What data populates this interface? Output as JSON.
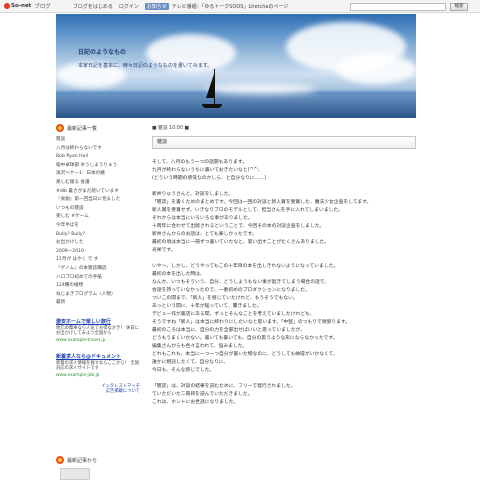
{
  "topbar": {
    "brand": "So-net",
    "blog_label": "ブログ",
    "nav": [
      "ブログをはじめる",
      "ログイン"
    ],
    "news_badge": "お知らせ",
    "news_text": "テレビ番組：「ゆるトークSOOS」Lhetchaのページ",
    "search_button": "検索"
  },
  "header": {
    "title": "日記のようなもの",
    "description": "本家日記を基本に、時々日記のようなものを書いてみます。"
  },
  "sidebar": {
    "heading": "最新記事一覧",
    "items": [
      "雑談",
      "八月は終わらないです",
      "Bob Ryan Hall",
      "稲中卓球部 ゆうしようりゅう",
      "滝沢ヘヤー1：日本の嬉",
      "楽しむ寝る 会議",
      "#dlb 暑さがまだ続いています",
      "『食劇』第一回当日に見ました",
      "いつもの雑談",
      "楽しむ #ゲーム",
      "今年半ばを",
      "Bully? Bully?",
      "お出かけした",
      "2009ー2010",
      "11月が はやく で す",
      "『ゲノム』の本雑誌購読",
      "ハロプロ初めての手紙",
      "124種の植物",
      "ねじまきプログラム（人物）",
      "最新"
    ],
    "ads": [
      {
        "title": "激安ホームで楽しい旅行",
        "text": "地元の電車なら人気でお得なかき！ 休日にお出かけしてみよう全国から",
        "url": "www.example-travel.jp"
      },
      {
        "title": "新着求人なら@ドキュメント",
        "text": "新着の求人情報を探すならここから！ 全国対応の求人サイトです",
        "url": "www.example-job.jp"
      }
    ],
    "ad_footer": [
      "インタレストマッチ",
      "広告掲載について"
    ],
    "heading2": "最新記事から"
  },
  "main": {
    "breadcrumb": "■ 雑談 10:00 ■",
    "entry_title": "雑談",
    "paragraphs": [
      [
        "そして、八月のもう一つの話題もあります。",
        "九月が終わらないうちに書いておきたいなと(^^;",
        "(どういう時期の感覚なのかしら、と自分なりに……)"
      ],
      [
        "新井りゅうさんと、対談をしました。",
        "「雑誌」を書くためのまとめです。今回は一回の対談と新人賞を受賞した、魔法少女企画をしてます。",
        "新人賞を受賞せず、いきなりプロのモデルとして、担当さんを手に入れてしまいました。",
        "それからは本当にいろいろな事がありました。",
        "十周年に合わせて出版されるということで、今回その本の対談企画をしました。",
        "新井さんからのお話は、とても楽しかったです。",
        "最初の頃は本当に一冊ずつ書いていたなと、思い出すことがたくさんありました。",
        "光栄です。"
      ],
      [
        "いや～、しかし、どうやってもこの十年目の本を出しきれないようになっていました。",
        "最初の本を出した時は、",
        "なんか、いつもそういう、自分、どうしようもない事が起きてしまう場合の話で、",
        "会話を持っていなかったので、一番初めのプロダクションになりました。",
        "ついこの間まで、「新人」を感じていたけれど、もうそうでもない。",
        "あっという間に、十年が経っていて、驚きました。",
        "デビュー作が書店にある間、ずっとそんなことを考えていましたけれども、",
        "そうですね「新人」は本当に終わりにしたいなと思います。「中堅」のつもりで頑張ります。",
        "最初のころは本当に、自分の力を全部出せばいいと思っていましたが、",
        "どうもうまくいかない。書いても書いても、自分の思うような形にならなかったです。",
        "編集さんからも色々言われて、悩みました。",
        "どれもこれも、本当に一つ一つ自分が書いた物なのに、どうしても納得がいかなくて、",
        "誰かに相談したくて、自分なりに、",
        "今日も、そんな感じでした。"
      ],
      [
        "「雑誌」は、対談の結果を読むために、フリーで発行されました。",
        "ていただいた二冊目を読んでいただきました。",
        "これは、ホントにお世話になりました。"
      ]
    ]
  }
}
